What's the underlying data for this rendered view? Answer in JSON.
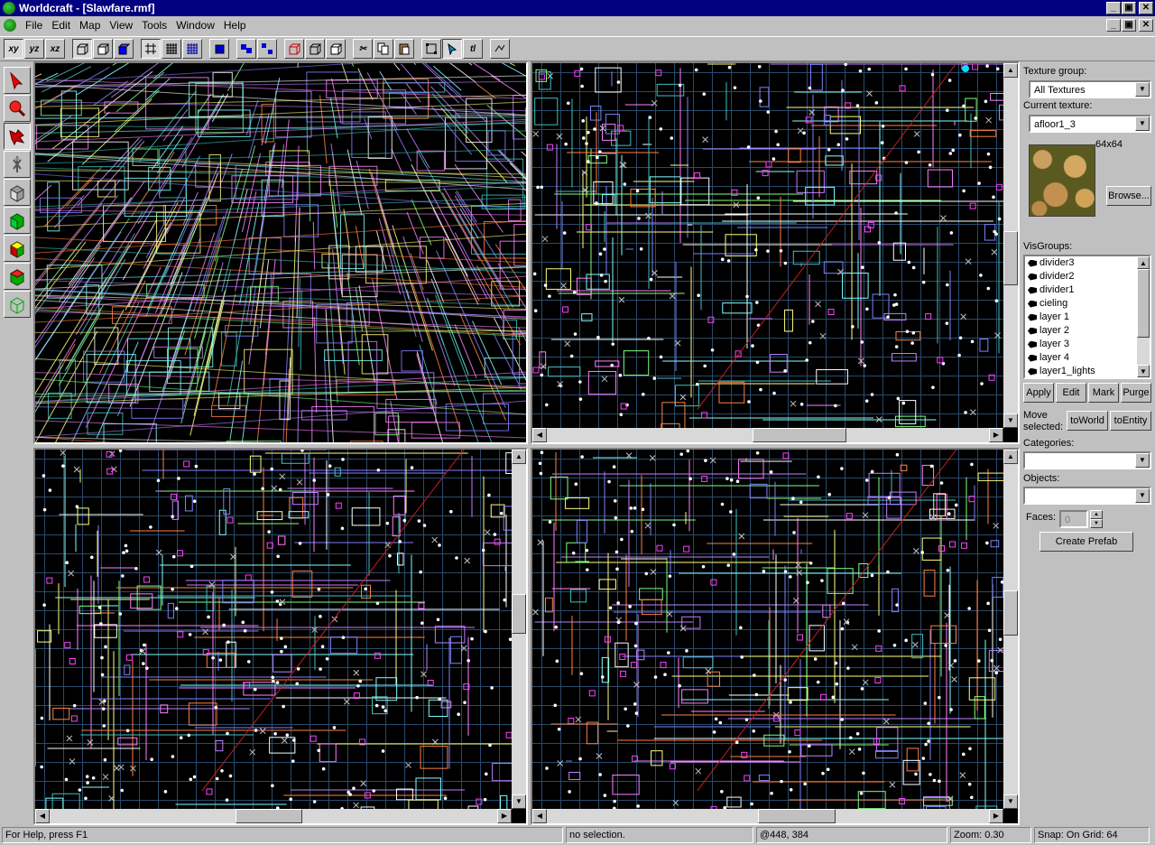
{
  "app": {
    "title": "Worldcraft - [Slawfare.rmf]",
    "window_buttons": [
      "_",
      "▣",
      "✕"
    ]
  },
  "menu": [
    "File",
    "Edit",
    "Map",
    "View",
    "Tools",
    "Window",
    "Help"
  ],
  "toolbar": {
    "view_buttons": [
      "xy",
      "yz",
      "xz"
    ]
  },
  "panel": {
    "texture_group_label": "Texture group:",
    "texture_group_value": "All Textures",
    "current_texture_label": "Current texture:",
    "current_texture_value": "afloor1_3",
    "texture_size": "64x64",
    "browse_label": "Browse...",
    "visgroups_label": "VisGroups:",
    "visgroups": [
      "divider3",
      "divider2",
      "divider1",
      "cieling",
      "layer 1",
      "layer 2",
      "layer 3",
      "layer 4",
      "layer1_lights"
    ],
    "apply_label": "Apply",
    "edit_label": "Edit",
    "mark_label": "Mark",
    "purge_label": "Purge",
    "move_selected_label": "Move selected:",
    "to_world_label": "toWorld",
    "to_entity_label": "toEntity",
    "categories_label": "Categories:",
    "categories_value": "",
    "objects_label": "Objects:",
    "objects_value": "",
    "faces_label": "Faces:",
    "faces_value": "0",
    "create_prefab_label": "Create Prefab"
  },
  "status": {
    "help": "For Help, press F1",
    "selection": "no selection.",
    "coords": "@448, 384",
    "zoom": "Zoom: 0.30",
    "snap": "Snap: On Grid: 64"
  },
  "colors": {
    "title_bg": "#000080",
    "viewport_bg": "#000000",
    "grid": "#2a4a6a"
  }
}
